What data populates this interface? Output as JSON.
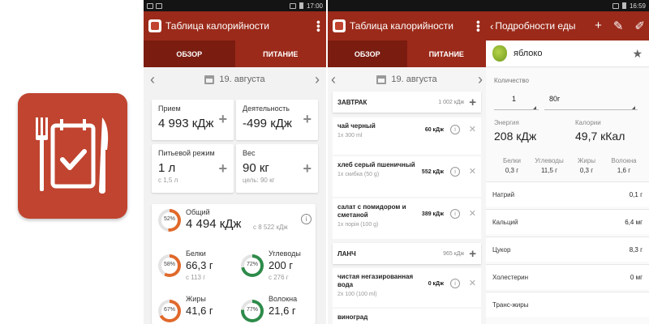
{
  "colors": {
    "brand": "#9b2a1a",
    "brand_dark": "#7a1c10",
    "icon_bg": "#c0442f",
    "ring_orange": "#e0692b",
    "ring_green": "#2e8b4a"
  },
  "status": {
    "time_left": "17:00",
    "time_right": "16:59"
  },
  "app": {
    "title": "Таблица калорийности"
  },
  "tabs": [
    {
      "label": "ОБЗОР"
    },
    {
      "label": "ПИТАНИЕ"
    }
  ],
  "overview": {
    "date": "19. августа",
    "cards": [
      {
        "label": "Прием",
        "value": "4 993 кДж",
        "sub": ""
      },
      {
        "label": "Деятельность",
        "value": "-499 кДж",
        "sub": ""
      },
      {
        "label": "Питьевой режим",
        "value": "1 л",
        "sub": "с 1,5 л"
      },
      {
        "label": "Вес",
        "value": "90 кг",
        "sub": "цель: 90 кг"
      }
    ],
    "total": {
      "percent": 52,
      "percent_label": "52%",
      "label": "Общий",
      "value": "4 494 кДж",
      "sub": "с 8 522 кДж"
    },
    "nutrients": [
      {
        "percent": 58,
        "percent_label": "58%",
        "label": "Белки",
        "value": "66,3 г",
        "sub": "с 113 г",
        "color": "#e0692b"
      },
      {
        "percent": 72,
        "percent_label": "72%",
        "label": "Углеводы",
        "value": "200 г",
        "sub": "с 276 г",
        "color": "#2e8b4a"
      },
      {
        "percent": 67,
        "percent_label": "67%",
        "label": "Жиры",
        "value": "41,6 г",
        "sub": "",
        "color": "#e0692b"
      },
      {
        "percent": 77,
        "percent_label": "77%",
        "label": "Волокна",
        "value": "21,6 г",
        "sub": "",
        "color": "#2e8b4a"
      }
    ]
  },
  "nutrition": {
    "date": "19. августа",
    "breakfast": {
      "title": "ЗАВТРАК",
      "kj": "1 002 кДж"
    },
    "breakfast_items": [
      {
        "name": "чай черный",
        "portion": "1x 300 ml",
        "kj": "60 кДж"
      },
      {
        "name": "хлеб серый пшеничный",
        "portion": "1x скибка (50 g)",
        "kj": "552 кДж"
      },
      {
        "name": "салат с помидором и сметаной",
        "portion": "1x порія (100 g)",
        "kj": "389 кДж"
      }
    ],
    "lunch": {
      "title": "ЛАНЧ",
      "kj": "965 кДж"
    },
    "lunch_items": [
      {
        "name": "чистая негазированная вода",
        "portion": "2x 100 (100 ml)",
        "kj": "0 кДж"
      },
      {
        "name": "виноград",
        "portion": "",
        "kj": ""
      }
    ]
  },
  "details": {
    "title": "Подробности еды",
    "food": "яблоко",
    "quantity_label": "Количество",
    "quantity": "1",
    "unit": "80г",
    "energy_label": "Энергия",
    "energy": "208 кДж",
    "calories_label": "Калории",
    "calories": "49,7 кКал",
    "macros": [
      {
        "label": "Белки",
        "value": "0,3 г"
      },
      {
        "label": "Углеводы",
        "value": "11,5 г"
      },
      {
        "label": "Жиры",
        "value": "0,3 г"
      },
      {
        "label": "Волокна",
        "value": "1,6 г"
      }
    ],
    "rows": [
      {
        "label": "Натрий",
        "value": "0,1 г"
      },
      {
        "label": "Кальций",
        "value": "6,4 мг"
      },
      {
        "label": "Цукор",
        "value": "8,3 г"
      },
      {
        "label": "Холестерин",
        "value": "0 мг"
      },
      {
        "label": "Транс-жиры",
        "value": ""
      }
    ]
  }
}
